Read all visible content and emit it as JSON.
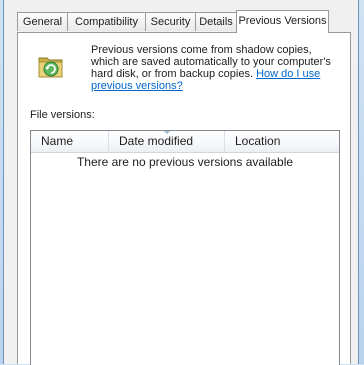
{
  "tabs": [
    {
      "label": "General"
    },
    {
      "label": "Compatibility"
    },
    {
      "label": "Security"
    },
    {
      "label": "Details"
    },
    {
      "label": "Previous Versions",
      "selected": true
    }
  ],
  "info": {
    "icon": "restore-folder-icon",
    "text": "Previous versions come from shadow copies, which are saved automatically to your computer's hard disk, or from backup copies. ",
    "link": "How do I use previous versions?"
  },
  "file_versions_label": "File versions:",
  "list": {
    "columns": [
      "Name",
      "Date modified",
      "Location"
    ],
    "sorted_column": "Date modified",
    "empty_message": "There are no previous versions available"
  }
}
